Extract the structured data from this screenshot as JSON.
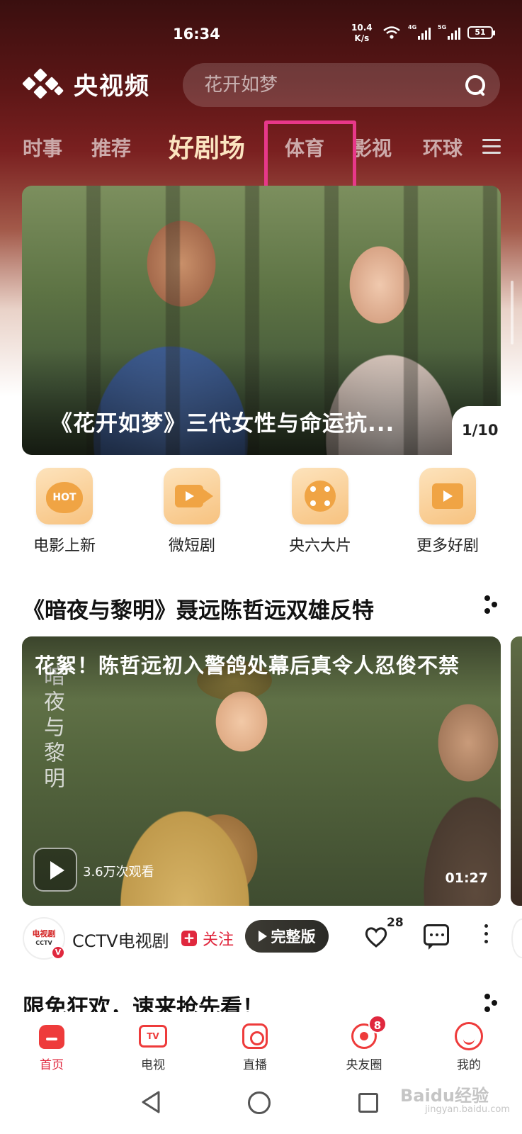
{
  "status": {
    "time": "16:34",
    "net_speed_value": "10.4",
    "net_speed_unit": "K/s",
    "sim1_tag": "4G",
    "sim2_tag": "5G",
    "battery": "51"
  },
  "header": {
    "app_name": "央视频",
    "search_placeholder": "花开如梦"
  },
  "tabs": [
    {
      "label": "时事"
    },
    {
      "label": "推荐"
    },
    {
      "label": "好剧场"
    },
    {
      "label": "体育"
    },
    {
      "label": "影视"
    },
    {
      "label": "环球"
    }
  ],
  "banner": {
    "title": "《花开如梦》三代女性与命运抗...",
    "page_indicator": "1/10"
  },
  "quick_links": [
    {
      "label": "电影上新",
      "icon": "hot-icon",
      "icon_text": "HOT"
    },
    {
      "label": "微短剧",
      "icon": "video-camera-icon"
    },
    {
      "label": "央六大片",
      "icon": "film-reel-icon"
    },
    {
      "label": "更多好剧",
      "icon": "play-folder-icon"
    }
  ],
  "section1": {
    "title": "《暗夜与黎明》聂远陈哲远双雄反特",
    "video": {
      "title": "花絮！陈哲远初入警鸽处幕后真令人忍俊不禁",
      "poster_text": "暗夜与黎明",
      "views": "3.6万次观看",
      "duration": "01:27"
    },
    "author": {
      "avatar_text_line1": "电视剧",
      "avatar_text_line2": "CCTV",
      "badge": "V",
      "name": "CCTV电视剧",
      "follow_label": "关注",
      "full_version_label": "完整版",
      "like_count": "28"
    }
  },
  "section2": {
    "title": "限免狂欢，速来抢先看！"
  },
  "bottom_nav": [
    {
      "label": "首页",
      "active": true
    },
    {
      "label": "电视",
      "icon_text": "TV"
    },
    {
      "label": "直播"
    },
    {
      "label": "央友圈",
      "badge": "8"
    },
    {
      "label": "我的"
    }
  ],
  "watermark": {
    "text": "Baidu经验",
    "sub": "jingyan.baidu.com"
  },
  "colors": {
    "accent": "#e0283e",
    "highlight_box": "#e8388a",
    "active_tab": "#fbe4c0"
  }
}
